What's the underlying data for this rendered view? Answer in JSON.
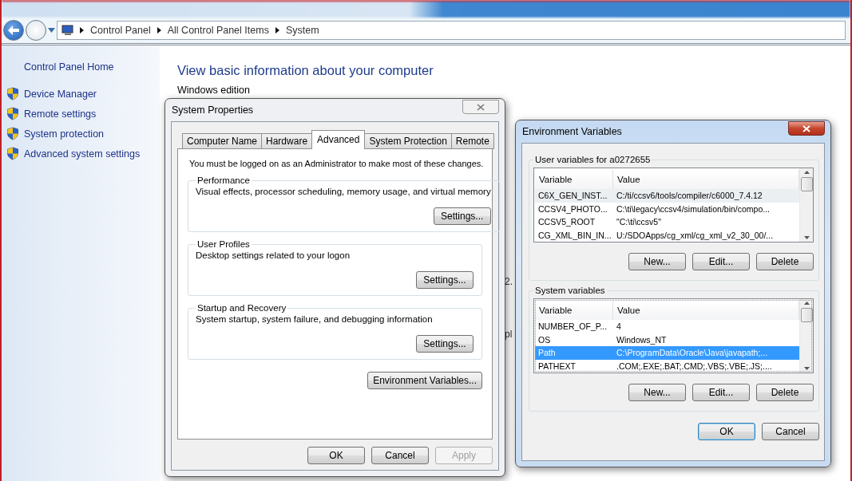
{
  "breadcrumb": [
    "Control Panel",
    "All Control Panel Items",
    "System"
  ],
  "sidebar": {
    "home": "Control Panel Home",
    "items": [
      "Device Manager",
      "Remote settings",
      "System protection",
      "Advanced system settings"
    ]
  },
  "main": {
    "heading": "View basic information about your computer",
    "section": "Windows edition",
    "fragments": [
      "2.",
      "pl"
    ]
  },
  "system_properties": {
    "title": "System Properties",
    "tabs": [
      {
        "label": "Computer Name",
        "selected": false
      },
      {
        "label": "Hardware",
        "selected": false
      },
      {
        "label": "Advanced",
        "selected": true
      },
      {
        "label": "System Protection",
        "selected": false
      },
      {
        "label": "Remote",
        "selected": false
      }
    ],
    "notice": "You must be logged on as an Administrator to make most of these changes.",
    "groups": [
      {
        "title": "Performance",
        "description": "Visual effects, processor scheduling, memory usage, and virtual memory",
        "button": "Settings..."
      },
      {
        "title": "User Profiles",
        "description": "Desktop settings related to your logon",
        "button": "Settings..."
      },
      {
        "title": "Startup and Recovery",
        "description": "System startup, system failure, and debugging information",
        "button": "Settings..."
      }
    ],
    "env_button": "Environment Variables...",
    "buttons": [
      {
        "label": "OK",
        "disabled": false
      },
      {
        "label": "Cancel",
        "disabled": false
      },
      {
        "label": "Apply",
        "disabled": true
      }
    ]
  },
  "environment_variables": {
    "title": "Environment Variables",
    "lists": [
      {
        "title": "User variables for a0272655",
        "focused": false,
        "columns": [
          "Variable",
          "Value"
        ],
        "rows": [
          {
            "variable": "C6X_GEN_INST...",
            "value": "C:/ti/ccsv6/tools/compiler/c6000_7.4.12",
            "selected": true
          },
          {
            "variable": "CCSV4_PHOTO...",
            "value": "C:\\ti\\legacy\\ccsv4/simulation/bin/compo...",
            "selected": false
          },
          {
            "variable": "CCSV5_ROOT",
            "value": "\"C:\\ti\\ccsv5\"",
            "selected": false
          },
          {
            "variable": "CG_XML_BIN_IN...",
            "value": "U:/SDOApps/cg_xml/cg_xml_v2_30_00/...",
            "selected": false
          }
        ],
        "buttons": [
          "New...",
          "Edit...",
          "Delete"
        ]
      },
      {
        "title": "System variables",
        "focused": true,
        "columns": [
          "Variable",
          "Value"
        ],
        "rows": [
          {
            "variable": "NUMBER_OF_P...",
            "value": "4",
            "selected": false
          },
          {
            "variable": "OS",
            "value": "Windows_NT",
            "selected": false
          },
          {
            "variable": "Path",
            "value": "C:\\ProgramData\\Oracle\\Java\\javapath;...",
            "selected": true
          },
          {
            "variable": "PATHEXT",
            "value": ".COM;.EXE;.BAT;.CMD;.VBS;.VBE;.JS;....",
            "selected": false
          }
        ],
        "buttons": [
          "New...",
          "Edit...",
          "Delete"
        ]
      }
    ],
    "buttons": [
      {
        "label": "OK",
        "default": true
      },
      {
        "label": "Cancel",
        "default": false
      }
    ]
  }
}
